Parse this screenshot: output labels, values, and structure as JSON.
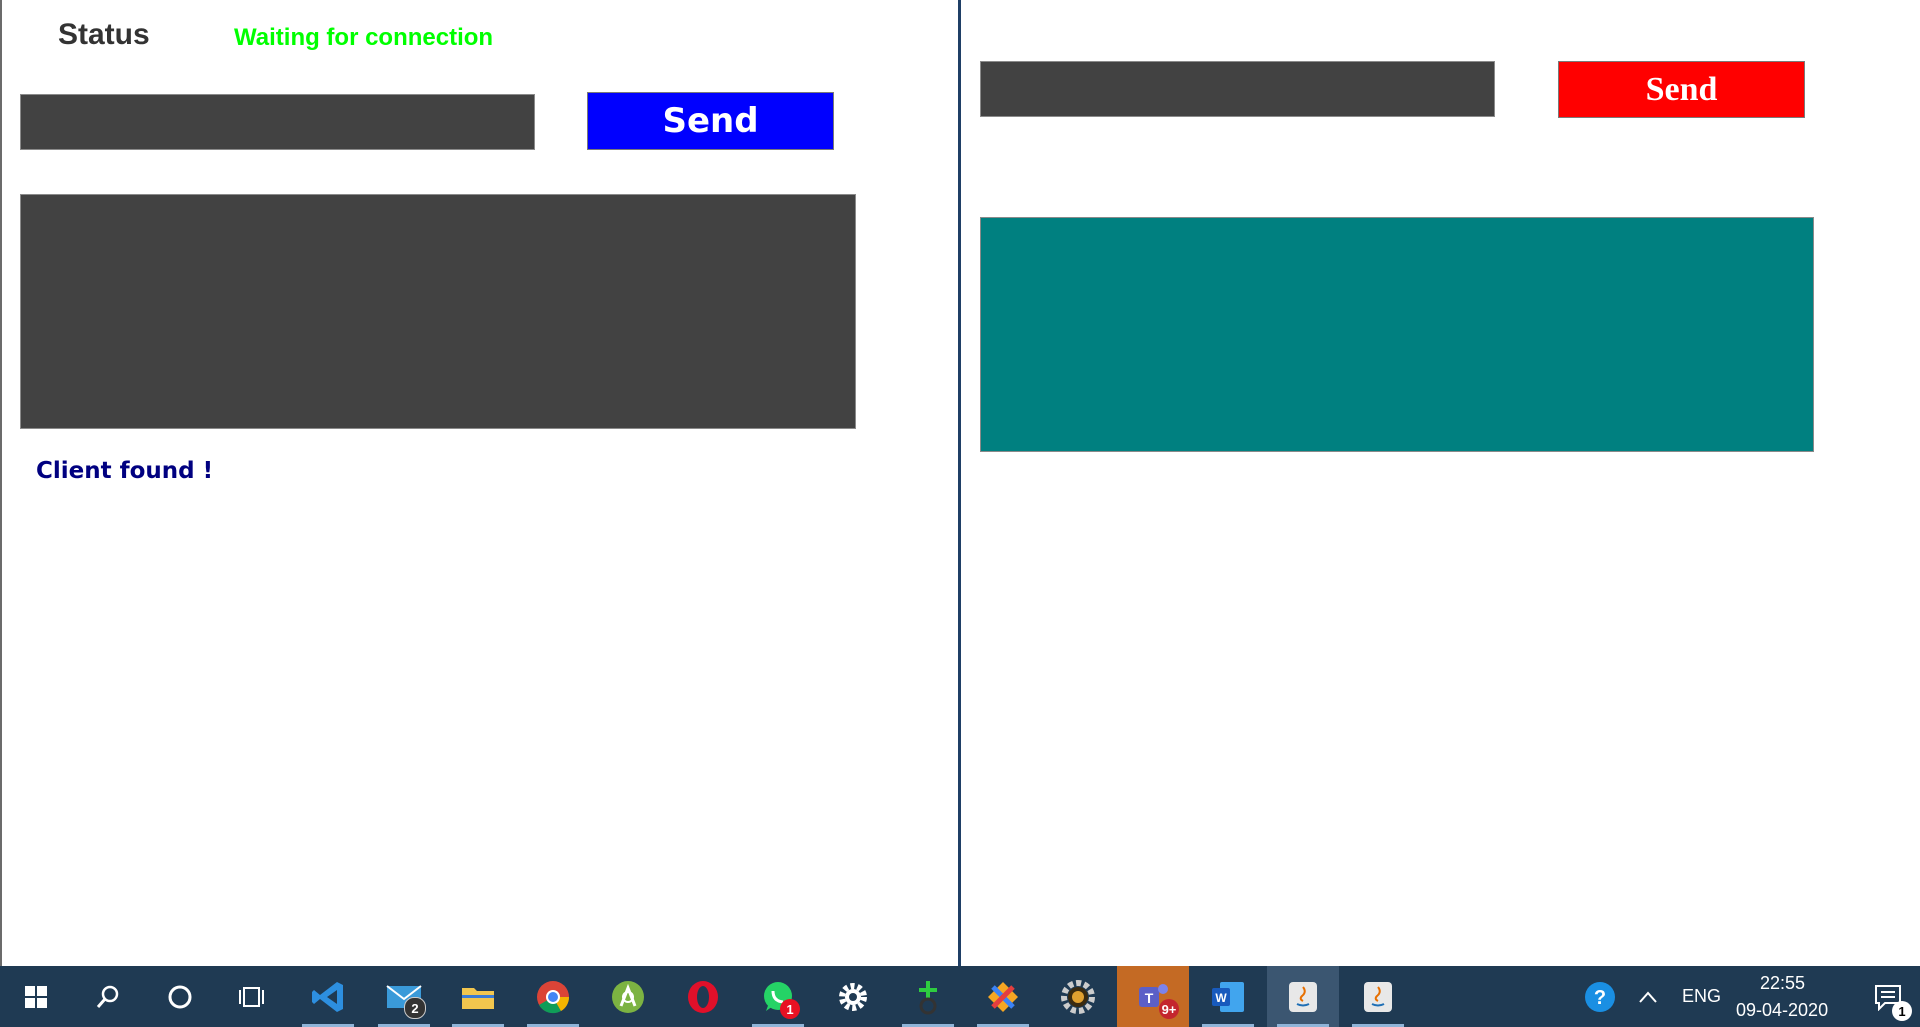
{
  "server": {
    "status_label": "Status",
    "status_text": "Waiting for connection",
    "status_color": "#00ff00",
    "message_input_value": "",
    "send_label": "Send",
    "send_color": "#0000ff",
    "chat_area_color": "#424242",
    "log_message": "Client found !"
  },
  "client": {
    "message_input_value": "",
    "send_label": "Send",
    "send_color": "#ff0000",
    "chat_area_color": "#008080"
  },
  "taskbar": {
    "apps": [
      {
        "name": "start-icon"
      },
      {
        "name": "search-icon"
      },
      {
        "name": "cortana-icon"
      },
      {
        "name": "task-view-icon"
      },
      {
        "name": "vscode-icon"
      },
      {
        "name": "mail-icon",
        "badge": "2"
      },
      {
        "name": "file-explorer-icon"
      },
      {
        "name": "chrome-icon"
      },
      {
        "name": "android-studio-icon"
      },
      {
        "name": "opera-icon"
      },
      {
        "name": "whatsapp-icon",
        "badge": "1"
      },
      {
        "name": "settings-icon"
      },
      {
        "name": "app-green-plus-icon"
      },
      {
        "name": "app-tool-icon"
      },
      {
        "name": "app-gear-icon"
      },
      {
        "name": "teams-icon",
        "badge": "9+"
      },
      {
        "name": "word-icon"
      },
      {
        "name": "java-icon-1"
      },
      {
        "name": "java-icon-2"
      }
    ],
    "tray": {
      "language": "ENG",
      "time": "22:55",
      "date": "09-04-2020",
      "notifications_badge": "1"
    }
  }
}
